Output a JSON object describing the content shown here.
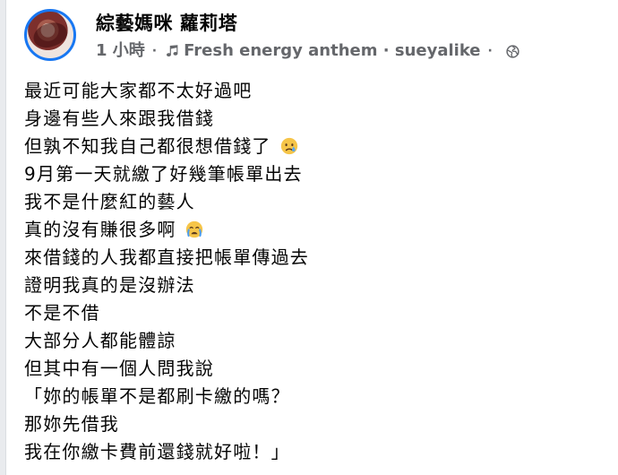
{
  "post": {
    "author": "綜藝媽咪 蘿莉塔",
    "meta": {
      "time": "1 小時",
      "separator": "·",
      "music_icon": "music-note-icon",
      "music_text": "Fresh energy anthem · sueyalike",
      "privacy_icon": "globe-icon"
    },
    "lines": [
      {
        "text": "最近可能大家都不太好過吧",
        "emoji": ""
      },
      {
        "text": "身邊有些人來跟我借錢",
        "emoji": ""
      },
      {
        "text": "但孰不知我自己都很想借錢了",
        "emoji": "sad-tear-emoji"
      },
      {
        "text": "9月第一天就繳了好幾筆帳單出去",
        "emoji": ""
      },
      {
        "text": "我不是什麼紅的藝人",
        "emoji": ""
      },
      {
        "text": "真的沒有賺很多啊",
        "emoji": "crying-emoji"
      },
      {
        "text": "來借錢的人我都直接把帳單傳過去",
        "emoji": ""
      },
      {
        "text": "證明我真的是沒辦法",
        "emoji": ""
      },
      {
        "text": "不是不借",
        "emoji": ""
      },
      {
        "text": "大部分人都能體諒",
        "emoji": ""
      },
      {
        "text": "但其中有一個人問我說",
        "emoji": ""
      },
      {
        "text": "「妳的帳單不是都刷卡繳的嗎？",
        "emoji": ""
      },
      {
        "text": "那妳先借我",
        "emoji": ""
      },
      {
        "text": "我在你繳卡費前還錢就好啦！」",
        "emoji": ""
      }
    ]
  },
  "colors": {
    "background": "#e9ebee",
    "card": "#ffffff",
    "primary_text": "#050505",
    "secondary_text": "#65676b",
    "avatar_ring": "#1877f2",
    "emoji_yellow": "#f6c549"
  }
}
